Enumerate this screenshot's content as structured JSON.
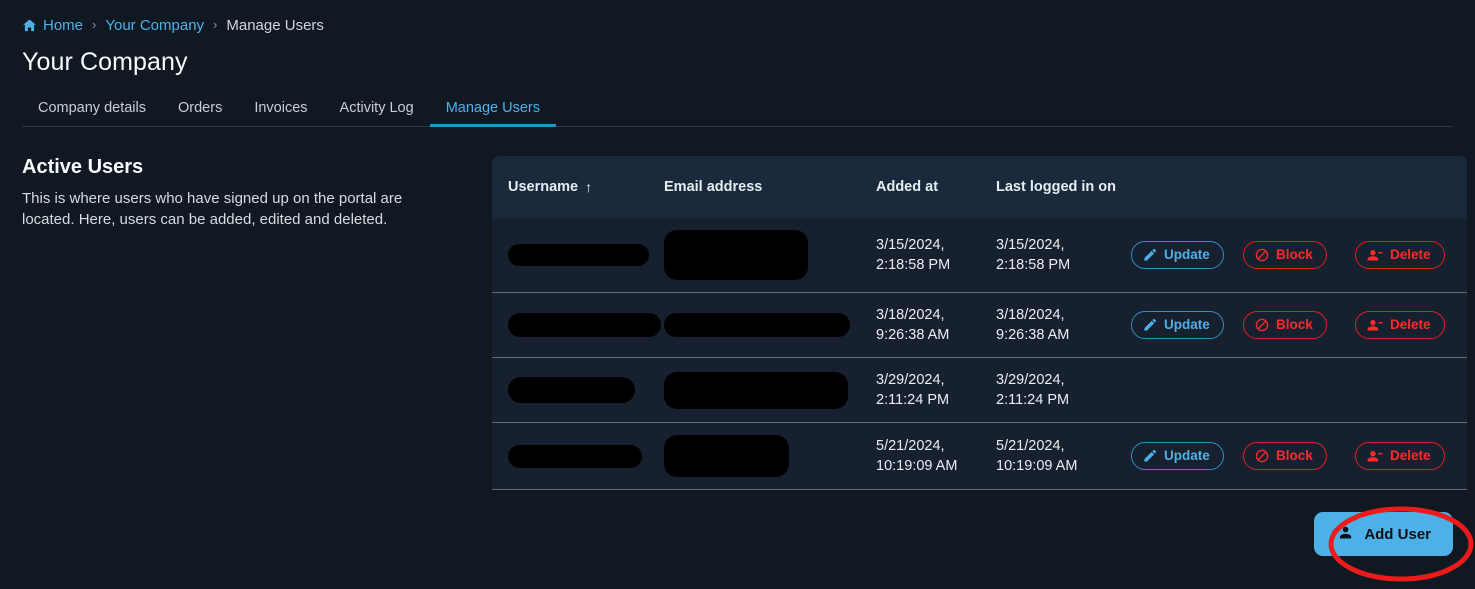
{
  "breadcrumb": {
    "home_icon": "home-icon",
    "home_label": "Home",
    "separator": "›",
    "company_label": "Your Company",
    "current_label": "Manage Users"
  },
  "page_title": "Your Company",
  "tabs": [
    {
      "label": "Company details",
      "active": false
    },
    {
      "label": "Orders",
      "active": false
    },
    {
      "label": "Invoices",
      "active": false
    },
    {
      "label": "Activity Log",
      "active": false
    },
    {
      "label": "Manage Users",
      "active": true
    }
  ],
  "left_panel": {
    "title": "Active Users",
    "description": "This is where users who have signed up on the portal are located. Here, users can be added, edited and deleted."
  },
  "table": {
    "columns": [
      {
        "label": "Username",
        "sort_icon": "arrow-up-icon",
        "sorted": true
      },
      {
        "label": "Email address",
        "sorted": false
      },
      {
        "label": "Added at",
        "sorted": false
      },
      {
        "label": "Last logged in on",
        "sorted": false
      },
      {
        "label": "",
        "sorted": false
      },
      {
        "label": "",
        "sorted": false
      },
      {
        "label": "",
        "sorted": false
      }
    ],
    "rows": [
      {
        "username": "",
        "username_redacted": true,
        "username_w": 141,
        "username_h": 22,
        "email": "",
        "email_redacted": true,
        "email_w": 144,
        "email_h": 50,
        "added_at": "3/15/2024,\n2:18:58 PM",
        "last_logged_in": "3/15/2024,\n2:18:58 PM",
        "actions": [
          "Update",
          "Block",
          "Delete"
        ]
      },
      {
        "username": "",
        "username_redacted": true,
        "username_w": 153,
        "username_h": 24,
        "email": "",
        "email_redacted": true,
        "email_w": 186,
        "email_h": 24,
        "added_at": "3/18/2024,\n9:26:38 AM",
        "last_logged_in": "3/18/2024,\n9:26:38 AM",
        "actions": [
          "Update",
          "Block",
          "Delete"
        ]
      },
      {
        "username": "",
        "username_redacted": true,
        "username_w": 127,
        "username_h": 26,
        "email": "",
        "email_redacted": true,
        "email_w": 184,
        "email_h": 37,
        "added_at": "3/29/2024,\n2:11:24 PM",
        "last_logged_in": "3/29/2024,\n2:11:24 PM",
        "actions": []
      },
      {
        "username": "",
        "username_redacted": true,
        "username_w": 134,
        "username_h": 23,
        "email": "",
        "email_redacted": true,
        "email_w": 125,
        "email_h": 42,
        "added_at": "5/21/2024,\n10:19:09 AM",
        "last_logged_in": "5/21/2024,\n10:19:09 AM",
        "actions": [
          "Update",
          "Block",
          "Delete"
        ]
      }
    ],
    "action_labels": {
      "update": "Update",
      "block": "Block",
      "delete": "Delete"
    },
    "action_icons": {
      "update": "pencil-icon",
      "block": "block-circle-slash-icon",
      "delete": "person-minus-icon"
    }
  },
  "add_user_button": {
    "label": "Add User",
    "icon": "person-plus-icon"
  },
  "annotation": {
    "shape": "ellipse-highlight",
    "color": "#ee1b1b",
    "target": "add-user-button"
  },
  "colors": {
    "page_bg": "#101822",
    "table_row_bg": "#16202e",
    "table_header_bg": "#1a2a3c",
    "accent_blue": "#4db1e8",
    "danger_red": "#fb2b2b",
    "row_divider": "#626c76"
  }
}
